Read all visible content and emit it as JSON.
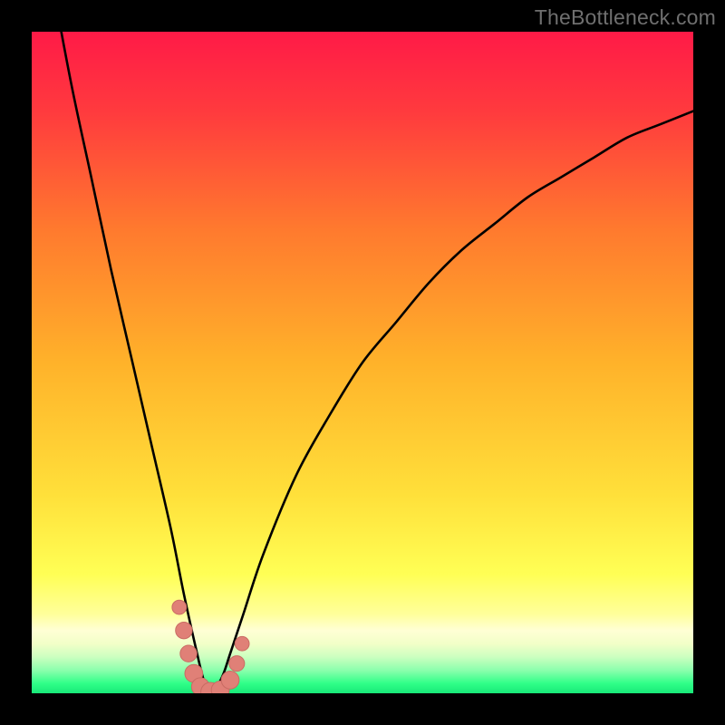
{
  "watermark": "TheBottleneck.com",
  "colors": {
    "top": "#ff1a47",
    "mid1": "#ff6a2e",
    "mid2": "#ffb22a",
    "mid3": "#ffe63a",
    "yellow_band": "#ffff8a",
    "pale": "#f7ffb0",
    "green_pale": "#b8ffb8",
    "green": "#1bff7a",
    "curve": "#000000",
    "marker_fill": "#e08077",
    "marker_stroke": "#c96b63"
  },
  "chart_data": {
    "type": "line",
    "title": "",
    "xlabel": "",
    "ylabel": "",
    "xlim": [
      0,
      100
    ],
    "ylim": [
      0,
      100
    ],
    "curve_description": "bottleneck-percentage curve: steep descent, near-zero trough around x≈27, rising tail",
    "x": [
      0,
      3,
      6,
      9,
      12,
      15,
      18,
      21,
      23,
      25,
      26,
      27,
      28,
      29,
      30,
      32,
      35,
      40,
      45,
      50,
      55,
      60,
      65,
      70,
      75,
      80,
      85,
      90,
      95,
      100
    ],
    "values": [
      125,
      108,
      92,
      78,
      64,
      51,
      38,
      25,
      15,
      6,
      2,
      0,
      1,
      3,
      6,
      12,
      21,
      33,
      42,
      50,
      56,
      62,
      67,
      71,
      75,
      78,
      81,
      84,
      86,
      88
    ],
    "markers": {
      "description": "highlighted data points near trough",
      "points": [
        {
          "x": 22.3,
          "y": 13.0,
          "r": 1.2
        },
        {
          "x": 23.0,
          "y": 9.5,
          "r": 1.4
        },
        {
          "x": 23.7,
          "y": 6.0,
          "r": 1.4
        },
        {
          "x": 24.5,
          "y": 3.0,
          "r": 1.5
        },
        {
          "x": 25.5,
          "y": 1.0,
          "r": 1.5
        },
        {
          "x": 27.0,
          "y": 0.2,
          "r": 1.6
        },
        {
          "x": 28.5,
          "y": 0.5,
          "r": 1.5
        },
        {
          "x": 30.0,
          "y": 2.0,
          "r": 1.5
        },
        {
          "x": 31.0,
          "y": 4.5,
          "r": 1.3
        },
        {
          "x": 31.8,
          "y": 7.5,
          "r": 1.2
        }
      ]
    }
  }
}
